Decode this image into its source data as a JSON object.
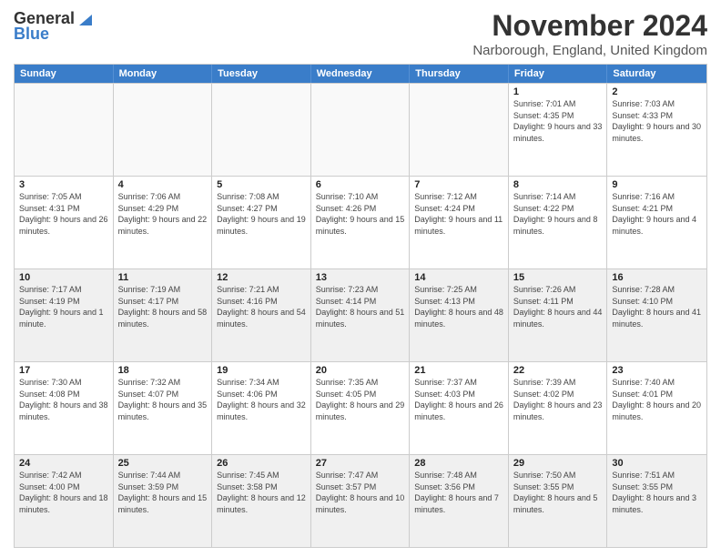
{
  "logo": {
    "line1": "General",
    "line2": "Blue"
  },
  "title": "November 2024",
  "location": "Narborough, England, United Kingdom",
  "header_days": [
    "Sunday",
    "Monday",
    "Tuesday",
    "Wednesday",
    "Thursday",
    "Friday",
    "Saturday"
  ],
  "weeks": [
    [
      {
        "day": "",
        "empty": true
      },
      {
        "day": "",
        "empty": true
      },
      {
        "day": "",
        "empty": true
      },
      {
        "day": "",
        "empty": true
      },
      {
        "day": "",
        "empty": true
      },
      {
        "day": "1",
        "info": "Sunrise: 7:01 AM\nSunset: 4:35 PM\nDaylight: 9 hours\nand 33 minutes."
      },
      {
        "day": "2",
        "info": "Sunrise: 7:03 AM\nSunset: 4:33 PM\nDaylight: 9 hours\nand 30 minutes."
      }
    ],
    [
      {
        "day": "3",
        "info": "Sunrise: 7:05 AM\nSunset: 4:31 PM\nDaylight: 9 hours\nand 26 minutes."
      },
      {
        "day": "4",
        "info": "Sunrise: 7:06 AM\nSunset: 4:29 PM\nDaylight: 9 hours\nand 22 minutes."
      },
      {
        "day": "5",
        "info": "Sunrise: 7:08 AM\nSunset: 4:27 PM\nDaylight: 9 hours\nand 19 minutes."
      },
      {
        "day": "6",
        "info": "Sunrise: 7:10 AM\nSunset: 4:26 PM\nDaylight: 9 hours\nand 15 minutes."
      },
      {
        "day": "7",
        "info": "Sunrise: 7:12 AM\nSunset: 4:24 PM\nDaylight: 9 hours\nand 11 minutes."
      },
      {
        "day": "8",
        "info": "Sunrise: 7:14 AM\nSunset: 4:22 PM\nDaylight: 9 hours\nand 8 minutes."
      },
      {
        "day": "9",
        "info": "Sunrise: 7:16 AM\nSunset: 4:21 PM\nDaylight: 9 hours\nand 4 minutes."
      }
    ],
    [
      {
        "day": "10",
        "shaded": true,
        "info": "Sunrise: 7:17 AM\nSunset: 4:19 PM\nDaylight: 9 hours\nand 1 minute."
      },
      {
        "day": "11",
        "shaded": true,
        "info": "Sunrise: 7:19 AM\nSunset: 4:17 PM\nDaylight: 8 hours\nand 58 minutes."
      },
      {
        "day": "12",
        "shaded": true,
        "info": "Sunrise: 7:21 AM\nSunset: 4:16 PM\nDaylight: 8 hours\nand 54 minutes."
      },
      {
        "day": "13",
        "shaded": true,
        "info": "Sunrise: 7:23 AM\nSunset: 4:14 PM\nDaylight: 8 hours\nand 51 minutes."
      },
      {
        "day": "14",
        "shaded": true,
        "info": "Sunrise: 7:25 AM\nSunset: 4:13 PM\nDaylight: 8 hours\nand 48 minutes."
      },
      {
        "day": "15",
        "shaded": true,
        "info": "Sunrise: 7:26 AM\nSunset: 4:11 PM\nDaylight: 8 hours\nand 44 minutes."
      },
      {
        "day": "16",
        "shaded": true,
        "info": "Sunrise: 7:28 AM\nSunset: 4:10 PM\nDaylight: 8 hours\nand 41 minutes."
      }
    ],
    [
      {
        "day": "17",
        "info": "Sunrise: 7:30 AM\nSunset: 4:08 PM\nDaylight: 8 hours\nand 38 minutes."
      },
      {
        "day": "18",
        "info": "Sunrise: 7:32 AM\nSunset: 4:07 PM\nDaylight: 8 hours\nand 35 minutes."
      },
      {
        "day": "19",
        "info": "Sunrise: 7:34 AM\nSunset: 4:06 PM\nDaylight: 8 hours\nand 32 minutes."
      },
      {
        "day": "20",
        "info": "Sunrise: 7:35 AM\nSunset: 4:05 PM\nDaylight: 8 hours\nand 29 minutes."
      },
      {
        "day": "21",
        "info": "Sunrise: 7:37 AM\nSunset: 4:03 PM\nDaylight: 8 hours\nand 26 minutes."
      },
      {
        "day": "22",
        "info": "Sunrise: 7:39 AM\nSunset: 4:02 PM\nDaylight: 8 hours\nand 23 minutes."
      },
      {
        "day": "23",
        "info": "Sunrise: 7:40 AM\nSunset: 4:01 PM\nDaylight: 8 hours\nand 20 minutes."
      }
    ],
    [
      {
        "day": "24",
        "shaded": true,
        "info": "Sunrise: 7:42 AM\nSunset: 4:00 PM\nDaylight: 8 hours\nand 18 minutes."
      },
      {
        "day": "25",
        "shaded": true,
        "info": "Sunrise: 7:44 AM\nSunset: 3:59 PM\nDaylight: 8 hours\nand 15 minutes."
      },
      {
        "day": "26",
        "shaded": true,
        "info": "Sunrise: 7:45 AM\nSunset: 3:58 PM\nDaylight: 8 hours\nand 12 minutes."
      },
      {
        "day": "27",
        "shaded": true,
        "info": "Sunrise: 7:47 AM\nSunset: 3:57 PM\nDaylight: 8 hours\nand 10 minutes."
      },
      {
        "day": "28",
        "shaded": true,
        "info": "Sunrise: 7:48 AM\nSunset: 3:56 PM\nDaylight: 8 hours\nand 7 minutes."
      },
      {
        "day": "29",
        "shaded": true,
        "info": "Sunrise: 7:50 AM\nSunset: 3:55 PM\nDaylight: 8 hours\nand 5 minutes."
      },
      {
        "day": "30",
        "shaded": true,
        "info": "Sunrise: 7:51 AM\nSunset: 3:55 PM\nDaylight: 8 hours\nand 3 minutes."
      }
    ]
  ]
}
